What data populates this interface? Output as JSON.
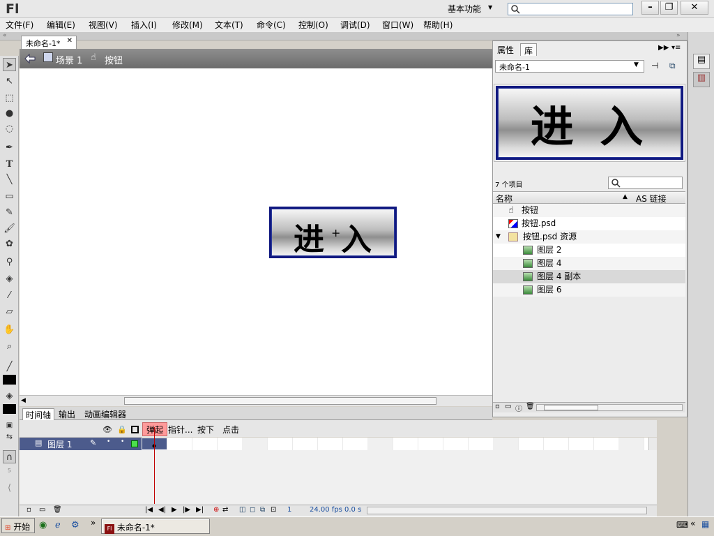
{
  "app": {
    "logo": "Fl",
    "workspace": "基本功能"
  },
  "menu": [
    "文件(F)",
    "编辑(E)",
    "视图(V)",
    "插入(I)",
    "修改(M)",
    "文本(T)",
    "命令(C)",
    "控制(O)",
    "调试(D)",
    "窗口(W)",
    "帮助(H)"
  ],
  "document": {
    "tab_label": "未命名-1*",
    "breadcrumb_scene": "场景 1",
    "breadcrumb_symbol": "按钮"
  },
  "stage": {
    "button_text_left": "进",
    "button_text_right": "入",
    "registration_mark": "+"
  },
  "panel": {
    "tab_properties": "属性",
    "tab_library": "库",
    "library_name": "未命名-1",
    "preview_text": "进 入",
    "item_count": "7 个项目",
    "col_name": "名称",
    "col_linkage": "AS 链接",
    "items": [
      {
        "label": "按钮"
      },
      {
        "label": "按钮.psd"
      },
      {
        "label": "按钮.psd 资源"
      },
      {
        "label": "图层 2"
      },
      {
        "label": "图层 4"
      },
      {
        "label": "图层 4 副本"
      },
      {
        "label": "图层 6"
      }
    ]
  },
  "timeline": {
    "tab_timeline": "时间轴",
    "tab_output": "输出",
    "tab_motion": "动画编辑器",
    "frame_labels": [
      "弹起",
      "指针...",
      "按下",
      "点击"
    ],
    "layer_name": "图层 1",
    "current_frame": "1",
    "fps": "24.00 fps",
    "time": "0.0 s"
  },
  "taskbar": {
    "start_label": "开始",
    "item_label": "未命名-1*"
  },
  "colors": {
    "accent_frame": "#ff9a9a",
    "playhead": "#c00000",
    "layer_selected": "#4c5b8c",
    "button_border": "#101880"
  }
}
